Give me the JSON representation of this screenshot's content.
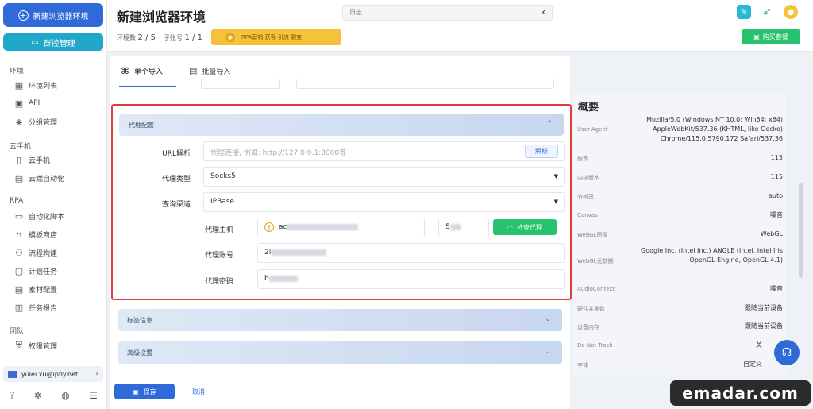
{
  "sidebar": {
    "new_env_button": "新建浏览器环境",
    "group_button": "群控管理",
    "sections": [
      {
        "title": "环境",
        "items": [
          {
            "label": "环境列表",
            "icon": "grid-icon"
          },
          {
            "label": "API",
            "icon": "api-icon"
          },
          {
            "label": "分组管理",
            "icon": "layers-icon"
          }
        ]
      },
      {
        "title": "云手机",
        "items": [
          {
            "label": "云手机",
            "icon": "phone-icon"
          },
          {
            "label": "云端自动化",
            "icon": "cloud-auto-icon"
          }
        ]
      },
      {
        "title": "RPA",
        "items": [
          {
            "label": "自动化脚本",
            "icon": "script-icon"
          },
          {
            "label": "模板商店",
            "icon": "store-icon"
          },
          {
            "label": "流程构建",
            "icon": "flow-icon"
          },
          {
            "label": "计划任务",
            "icon": "schedule-icon"
          },
          {
            "label": "素材配置",
            "icon": "material-icon"
          },
          {
            "label": "任务报告",
            "icon": "report-icon"
          }
        ]
      },
      {
        "title": "团队",
        "items": [
          {
            "label": "权限管理",
            "icon": "shield-icon"
          }
        ]
      }
    ],
    "user_email": "yulei.xu@ipfly.net"
  },
  "header": {
    "title": "新建浏览器环境",
    "log_placeholder": "日志",
    "env_count_label": "环境数",
    "env_count": "2 / 5",
    "sub_account_label": "子账号",
    "sub_account_count": "1 / 1",
    "rpa_banner": "RPA营销 获客 引流 裂变",
    "review_button": "购买套餐"
  },
  "tabs": [
    {
      "label": "单个导入",
      "icon": "single-import-icon",
      "active": true
    },
    {
      "label": "批量导入",
      "icon": "batch-import-icon",
      "active": false
    }
  ],
  "proxy": {
    "section_title": "代理配置",
    "url_parse_label": "URL解析",
    "url_placeholder": "代理连接, 例如: http://127.0.0.1:3000等",
    "parse_button": "解析",
    "proxy_type_label": "代理类型",
    "proxy_type_value": "Socks5",
    "query_channel_label": "查询渠道",
    "query_channel_value": "IPBase",
    "host_label": "代理主机",
    "host_value": "ac",
    "port_value": "5",
    "check_button": "检查代理",
    "account_label": "代理账号",
    "account_value": "2I",
    "password_label": "代理密码",
    "password_value": "b"
  },
  "collapsed_sections": [
    {
      "title": "标签信息"
    },
    {
      "title": "高级设置"
    }
  ],
  "footer": {
    "save_button": "保存",
    "cancel_link": "取消"
  },
  "overview": {
    "title": "概要",
    "rows": [
      {
        "key": "User-Agent",
        "value": "Mozilla/5.0 (Windows NT 10.0; Win64; x64) AppleWebKit/537.36 (KHTML, like Gecko) Chrome/115.0.5790.172 Safari/537.36"
      },
      {
        "key": "版本",
        "value": "115"
      },
      {
        "key": "内核版本",
        "value": "115"
      },
      {
        "key": "分辨率",
        "value": "auto"
      },
      {
        "key": "Canvas",
        "value": "噪音"
      },
      {
        "key": "WebGL图像",
        "value": "WebGL"
      },
      {
        "key": "WebGL元数据",
        "value": "Google Inc. (Intel Inc.) ANGLE (Intel, Intel Iris OpenGL Engine, OpenGL 4.1)"
      },
      {
        "key": "AudioContext",
        "value": "噪音"
      },
      {
        "key": "硬件并发数",
        "value": "跟随当前设备"
      },
      {
        "key": "设备内存",
        "value": "跟随当前设备"
      },
      {
        "key": "Do Not Track",
        "value": "关"
      },
      {
        "key": "字体",
        "value": "自定义"
      }
    ]
  },
  "watermark": "emadar.com",
  "colors": {
    "primary": "#2f6ad8",
    "green": "#27c26d",
    "highlight_border": "#e0403b",
    "banner": "#f6c23a"
  }
}
